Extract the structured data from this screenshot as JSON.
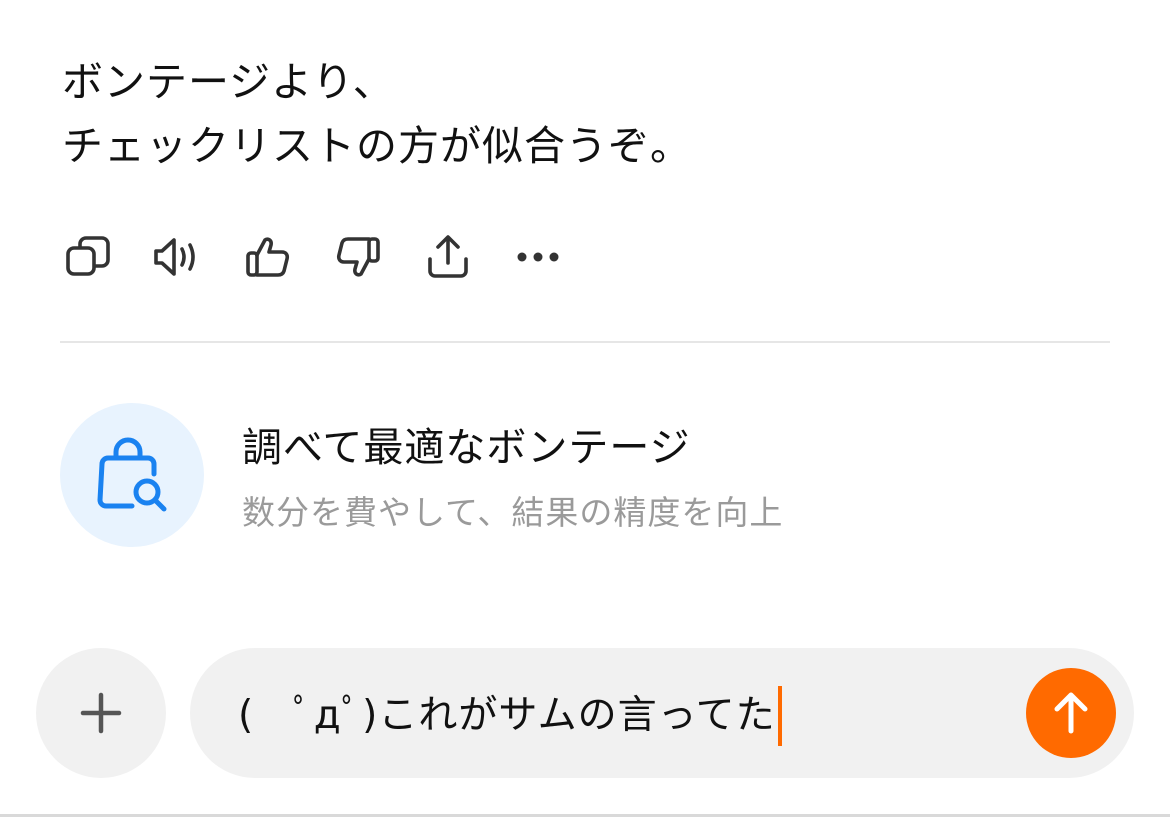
{
  "message": {
    "lines": [
      "ボンテージより、",
      "チェックリストの方が似合うぞ。"
    ]
  },
  "actions": [
    {
      "icon": "copy-icon"
    },
    {
      "icon": "speaker-icon"
    },
    {
      "icon": "thumbs-up-icon"
    },
    {
      "icon": "thumbs-down-icon"
    },
    {
      "icon": "share-icon"
    },
    {
      "icon": "more-icon"
    }
  ],
  "suggestion": {
    "icon": "shopping-bag-search-icon",
    "title": "調べて最適なボンテージ",
    "subtitle": "数分を費やして、結果の精度を向上"
  },
  "composer": {
    "plus_icon": "plus-icon",
    "input_value": "(　ﾟдﾟ)これがサムの言ってた",
    "send_icon": "arrow-up-icon"
  },
  "colors": {
    "accent": "#ff6a00",
    "suggestion_icon": "#1a82f0",
    "suggestion_bg": "#e8f3fe",
    "pill_bg": "#f1f1f1",
    "muted_text": "#9a9a9a"
  }
}
